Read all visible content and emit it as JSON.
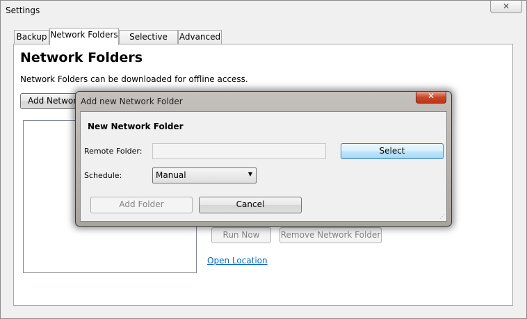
{
  "window": {
    "title": "Settings",
    "close_glyph": "✕"
  },
  "tabs": [
    {
      "label": "Backup"
    },
    {
      "label": "Network Folders"
    },
    {
      "label": "Selective Sync"
    },
    {
      "label": "Advanced"
    }
  ],
  "panel": {
    "heading": "Network Folders",
    "description": "Network Folders can be downloaded for offline access.",
    "add_button": "Add Network Folder",
    "run_now_button": "Run Now",
    "remove_button": "Remove Network Folder",
    "open_location_link": "Open Location"
  },
  "dialog": {
    "title": "Add new Network Folder",
    "close_glyph": "✕",
    "heading": "New Network Folder",
    "remote_folder_label": "Remote Folder:",
    "remote_folder_value": "",
    "select_button": "Select",
    "schedule_label": "Schedule:",
    "schedule_value": "Manual",
    "add_folder_button": "Add Folder",
    "cancel_button": "Cancel"
  },
  "icons": {
    "dropdown": "chevron-down-icon",
    "grip": "resize-grip-icon"
  }
}
